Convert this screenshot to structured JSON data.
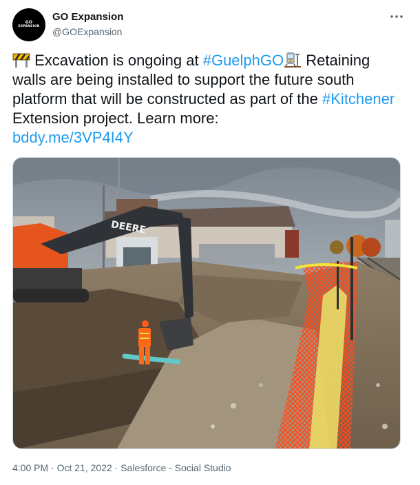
{
  "tweet": {
    "author": {
      "display_name": "GO Expansion",
      "handle": "@GOExpansion",
      "avatar_text_1": "GO",
      "avatar_text_2": "EXPANSION"
    },
    "more_icon": "more-horizontal-icon",
    "text": {
      "part1": " Excavation is ongoing at ",
      "hashtag1": "#GuelphGO",
      "part2": " Retaining walls are being installed to support the future south platform that will be constructed as part of the ",
      "hashtag2": "#Kitchener",
      "part3": " Extension project. Learn more: ",
      "link": "bddy.me/3VP4I4Y"
    },
    "emojis": [
      "construction-barrier-emoji",
      "railway-station-emoji"
    ],
    "media": {
      "description_icon": "photo",
      "machine_brand": "DEERE"
    },
    "meta": {
      "time": "4:00 PM",
      "date": "Oct 21, 2022",
      "separator": "·",
      "source": "Salesforce - Social Studio"
    },
    "colors": {
      "link": "#1d9bf0",
      "secondary_text": "#536471",
      "primary_text": "#0f1419"
    }
  }
}
